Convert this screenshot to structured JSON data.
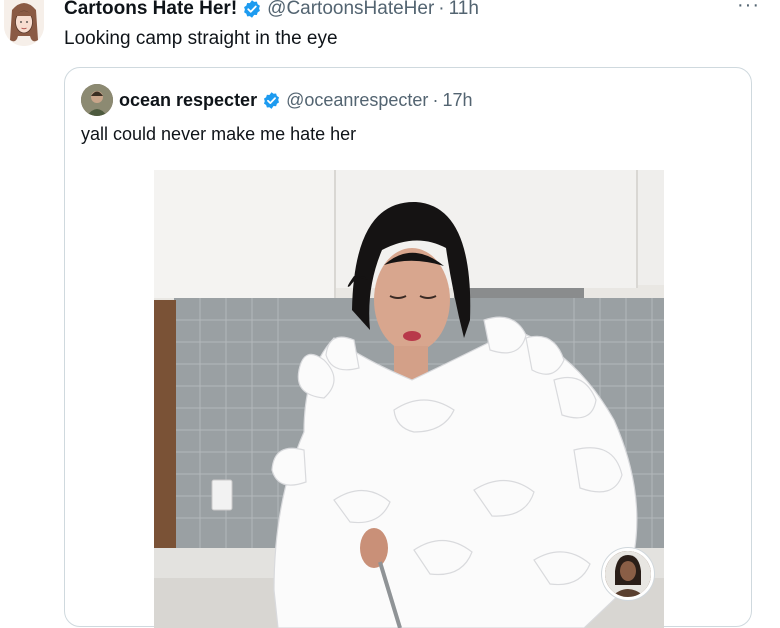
{
  "tweet": {
    "author_name": "Cartoons Hate Her!",
    "author_handle": "@CartoonsHateHer",
    "separator": "·",
    "timestamp": "11h",
    "text": "Looking camp straight in the eye",
    "more_label": "···",
    "avatar_icon": "illustrated-woman-avatar"
  },
  "quoted": {
    "author_name": "ocean respecter",
    "author_handle": "@oceanrespecter",
    "separator": "·",
    "timestamp": "17h",
    "text": "yall could never make me hate her",
    "avatar_icon": "photo-avatar"
  },
  "colors": {
    "verified": "#1d9bf0",
    "muted_text": "#536471",
    "border": "#cfd9de"
  }
}
